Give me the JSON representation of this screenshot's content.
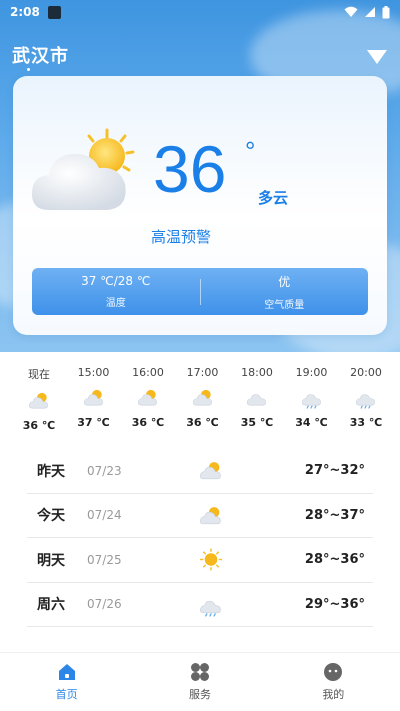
{
  "status_bar": {
    "time": "2:08"
  },
  "header": {
    "city": "武汉市"
  },
  "current": {
    "temperature": "36",
    "degree": "°",
    "condition": "多云",
    "warning": "高温预警",
    "temp_range": "37 ℃/28 ℃",
    "temp_label": "温度",
    "aqi": "优",
    "aqi_label": "空气质量",
    "icon": "partly-cloudy-icon"
  },
  "hourly": [
    {
      "time": "现在",
      "temp": "36 ℃",
      "icon": "partly-cloudy-icon"
    },
    {
      "time": "15:00",
      "temp": "37 ℃",
      "icon": "partly-cloudy-icon"
    },
    {
      "time": "16:00",
      "temp": "36 ℃",
      "icon": "partly-cloudy-icon"
    },
    {
      "time": "17:00",
      "temp": "36 ℃",
      "icon": "partly-cloudy-icon"
    },
    {
      "time": "18:00",
      "temp": "35 ℃",
      "icon": "cloudy-icon"
    },
    {
      "time": "19:00",
      "temp": "34 ℃",
      "icon": "rain-icon"
    },
    {
      "time": "20:00",
      "temp": "33 ℃",
      "icon": "rain-icon"
    }
  ],
  "daily": [
    {
      "day": "昨天",
      "date": "07/23",
      "range": "27°~32°",
      "icon": "partly-cloudy-icon"
    },
    {
      "day": "今天",
      "date": "07/24",
      "range": "28°~37°",
      "icon": "partly-cloudy-icon"
    },
    {
      "day": "明天",
      "date": "07/25",
      "range": "28°~36°",
      "icon": "sunny-icon"
    },
    {
      "day": "周六",
      "date": "07/26",
      "range": "29°~36°",
      "icon": "rain-icon"
    }
  ],
  "tabs": [
    {
      "label": "首页",
      "icon": "home-icon",
      "active": true
    },
    {
      "label": "服务",
      "icon": "grid-icon",
      "active": false
    },
    {
      "label": "我的",
      "icon": "profile-icon",
      "active": false
    }
  ],
  "colors": {
    "accent": "#1b7fe8",
    "sky": "#5aa8ea"
  }
}
